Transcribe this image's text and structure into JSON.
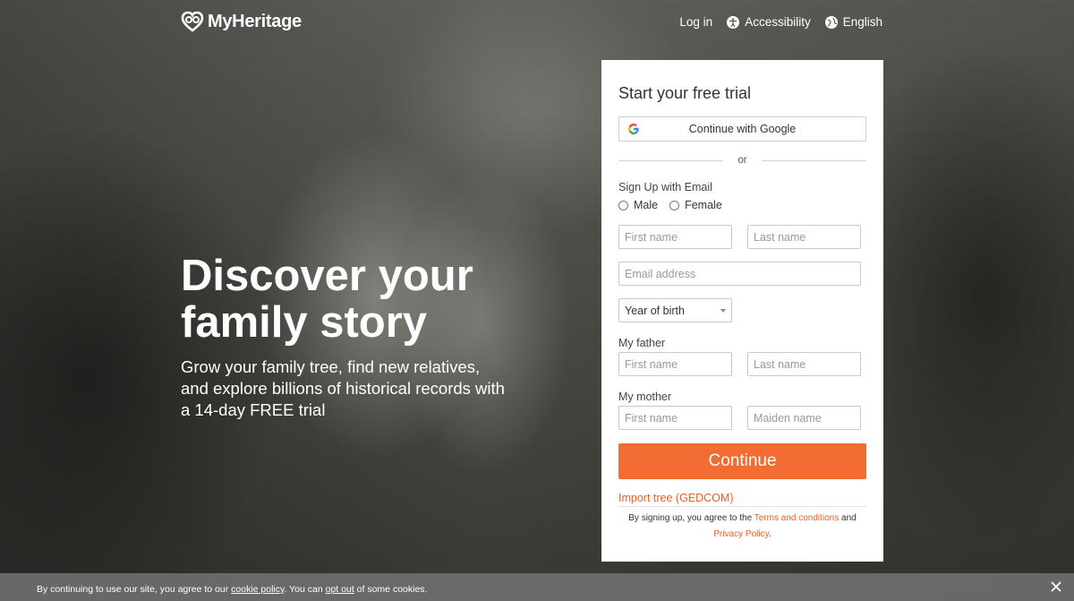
{
  "header": {
    "logo_text": "MyHeritage",
    "nav": {
      "login": "Log in",
      "accessibility": "Accessibility",
      "language": "English"
    }
  },
  "hero": {
    "title": "Discover your family story",
    "subtitle": "Grow your family tree, find new relatives, and explore billions of historical records with a 14-day FREE trial"
  },
  "form": {
    "title": "Start your free trial",
    "google_button": "Continue with Google",
    "or_text": "or",
    "signup_label": "Sign Up with Email",
    "gender": {
      "male": "Male",
      "female": "Female"
    },
    "first_name_placeholder": "First name",
    "last_name_placeholder": "Last name",
    "email_placeholder": "Email address",
    "year_of_birth": "Year of birth",
    "father_label": "My father",
    "father_first_placeholder": "First name",
    "father_last_placeholder": "Last name",
    "mother_label": "My mother",
    "mother_first_placeholder": "First name",
    "mother_maiden_placeholder": "Maiden name",
    "continue_button": "Continue",
    "import_link": "Import tree (GEDCOM)",
    "terms_prefix": "By signing up, you agree to the",
    "terms_link": "Terms and conditions",
    "terms_and": "and",
    "privacy_link": "Privacy Policy",
    "terms_suffix": "."
  },
  "cookie": {
    "prefix": "By continuing to use our site, you agree to our",
    "cookie_policy": "cookie policy",
    "middle": ". You can",
    "opt_out": "opt out",
    "suffix": "of some cookies."
  },
  "colors": {
    "accent": "#f26c33",
    "link": "#e8602a"
  }
}
